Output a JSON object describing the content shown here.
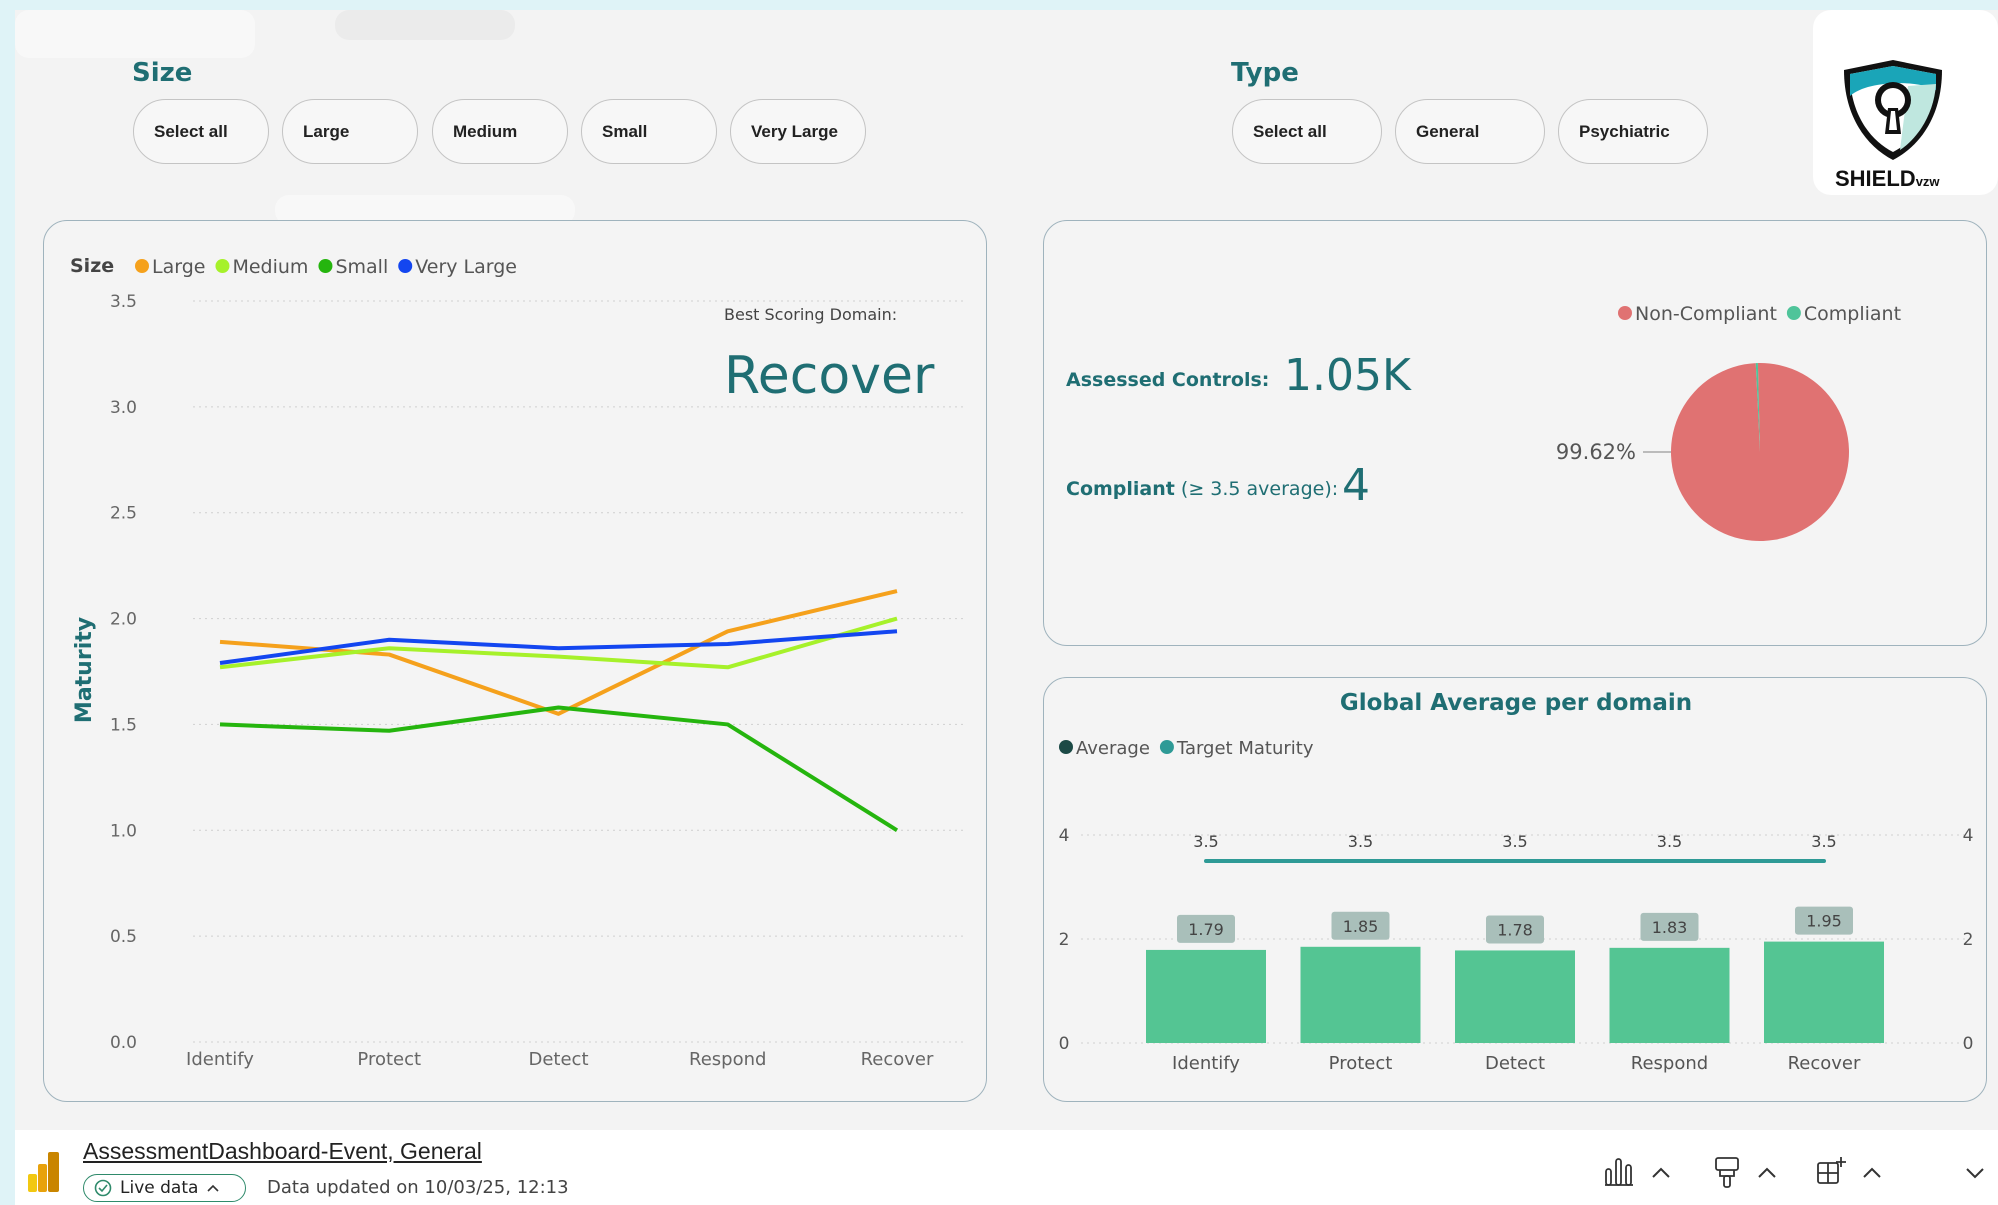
{
  "filters": {
    "size": {
      "title": "Size",
      "options": [
        "Select all",
        "Large",
        "Medium",
        "Small",
        "Very Large"
      ]
    },
    "type": {
      "title": "Type",
      "options": [
        "Select all",
        "General",
        "Psychiatric"
      ]
    }
  },
  "logo": {
    "name": "SHIELD",
    "suffix": "vzw"
  },
  "maturity_panel": {
    "best_domain_label": "Best Scoring Domain:",
    "best_domain_value": "Recover"
  },
  "compliance_panel": {
    "assessed_label": "Assessed Controls:",
    "assessed_value": "1.05K",
    "compliant_label": "Compliant",
    "compliant_qualifier": "(≥ 3.5 average):",
    "compliant_value": "4"
  },
  "chart_data": [
    {
      "type": "line",
      "legend_title": "Size",
      "categories": [
        "Identify",
        "Protect",
        "Detect",
        "Respond",
        "Recover"
      ],
      "ylabel": "Maturity",
      "ylim": [
        0,
        3.5
      ],
      "yticks": [
        "0.0",
        "0.5",
        "1.0",
        "1.5",
        "2.0",
        "2.5",
        "3.0",
        "3.5"
      ],
      "grid": true,
      "legend_position": "top-left",
      "series": [
        {
          "name": "Large",
          "color": "#f5a11c",
          "values": [
            1.89,
            1.83,
            1.55,
            1.94,
            2.13
          ]
        },
        {
          "name": "Medium",
          "color": "#a6f12a",
          "values": [
            1.77,
            1.86,
            1.82,
            1.77,
            2.0
          ]
        },
        {
          "name": "Small",
          "color": "#25b50e",
          "values": [
            1.5,
            1.47,
            1.58,
            1.5,
            1.0
          ]
        },
        {
          "name": "Very Large",
          "color": "#1346f0",
          "values": [
            1.79,
            1.9,
            1.86,
            1.88,
            1.94
          ]
        }
      ]
    },
    {
      "type": "pie",
      "legend_position": "top-right",
      "slices": [
        {
          "name": "Non-Compliant",
          "value": 99.62,
          "label": "99.62%",
          "color": "#e07272"
        },
        {
          "name": "Compliant",
          "value": 0.38,
          "label": "",
          "color": "#4fc49a"
        }
      ]
    },
    {
      "type": "bar",
      "title": "Global Average per domain",
      "categories": [
        "Identify",
        "Protect",
        "Detect",
        "Respond",
        "Recover"
      ],
      "legend_position": "top-left",
      "ylim": [
        0,
        4
      ],
      "yticks": [
        "0",
        "2",
        "4"
      ],
      "series": [
        {
          "name": "Average",
          "color": "#54c593",
          "legend_color": "#1c4a46",
          "values": [
            1.79,
            1.85,
            1.78,
            1.83,
            1.95
          ]
        },
        {
          "name": "Target Maturity",
          "color": "#2e9a96",
          "values": [
            3.5,
            3.5,
            3.5,
            3.5,
            3.5
          ]
        }
      ]
    }
  ],
  "footer": {
    "report_title": "AssessmentDashboard-Event, General",
    "live_label": "Live data",
    "updated_text": "Data updated on 10/03/25, 12:13"
  }
}
